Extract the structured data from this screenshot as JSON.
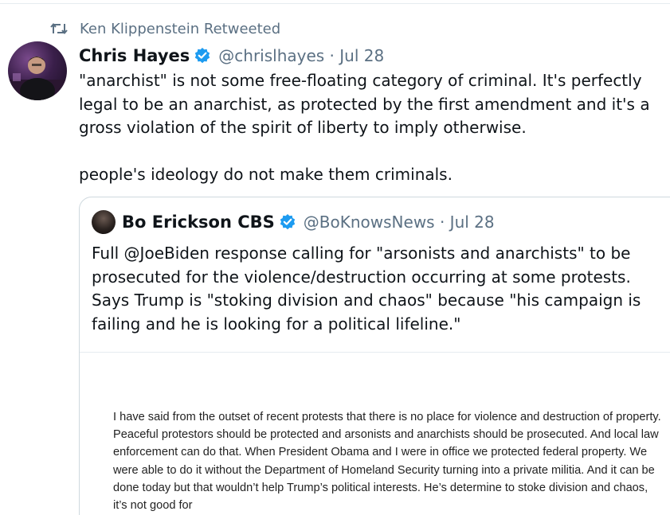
{
  "retweet": {
    "label": "Ken Klippenstein Retweeted",
    "icon": "retweet-icon"
  },
  "tweet": {
    "author_name": "Chris Hayes",
    "verified": true,
    "handle_date": "@chrislhayes · Jul 28",
    "text": "\"anarchist\" is not some free-floating category of criminal. It's perfectly legal to be an anarchist, as protected by the first amendment and it's a gross violation of the spirit of liberty to imply otherwise.\n\npeople's ideology do not make them criminals."
  },
  "quoted_tweet": {
    "author_name": "Bo Erickson CBS",
    "verified": true,
    "handle_date": "@BoKnowsNews · Jul 28",
    "text": "Full @JoeBiden response calling for \"arsonists and anarchists\" to be prosecuted for the violence/destruction occurring at some protests. Says Trump is \"stoking division and chaos\" because \"his campaign is failing and he is looking for a political lifeline.\"",
    "image_text": "I have said from the outset of recent protests that there is no place for violence and destruction of property. Peaceful protestors should be protected and arsonists and anarchists should be prosecuted. And local law enforcement can do that. When President Obama and I were in office we protected federal property. We were able to do it without the Department of Homeland Security turning into a private militia. And it can be done today but that wouldn’t help Trump’s political interests. He’s determine to stoke division and chaos, it’s not good for"
  },
  "colors": {
    "verified_blue": "#1d9bf0",
    "secondary_text": "#5b7083",
    "border": "#cfd9de"
  }
}
